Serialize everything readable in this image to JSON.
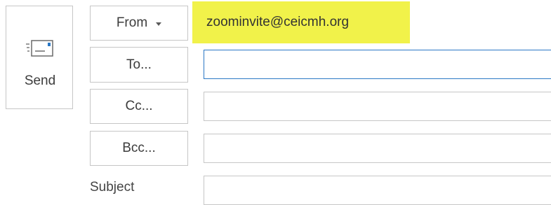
{
  "send": {
    "label": "Send",
    "icon": "envelope-send-icon"
  },
  "from": {
    "label": "From",
    "address": "zoominvite@ceicmh.org",
    "highlight_color": "#f1f24a"
  },
  "to": {
    "label": "To...",
    "value": ""
  },
  "cc": {
    "label": "Cc...",
    "value": ""
  },
  "bcc": {
    "label": "Bcc...",
    "value": ""
  },
  "subject": {
    "label": "Subject",
    "value": ""
  },
  "colors": {
    "focus_border": "#2b78c5",
    "border": "#c6c6c6"
  }
}
